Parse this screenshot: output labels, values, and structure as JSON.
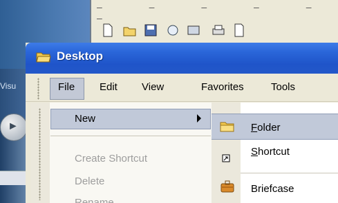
{
  "background": {
    "caption_fragment": "Visu"
  },
  "window": {
    "title": "Desktop",
    "icon": "folder-open-icon"
  },
  "menubar": {
    "items": [
      "File",
      "Edit",
      "View",
      "Favorites",
      "Tools"
    ]
  },
  "file_menu": {
    "new_label": "New",
    "create_shortcut": "Create Shortcut",
    "delete": "Delete",
    "rename": "Rename"
  },
  "new_submenu": {
    "folder_first": "F",
    "folder_rest": "older",
    "shortcut_first": "S",
    "shortcut_rest": "hortcut",
    "briefcase": "Briefcase"
  },
  "colors": {
    "title_bar": "#2a66d9",
    "highlight": "#c1c9d9",
    "menu_bg": "#ece9d8"
  }
}
